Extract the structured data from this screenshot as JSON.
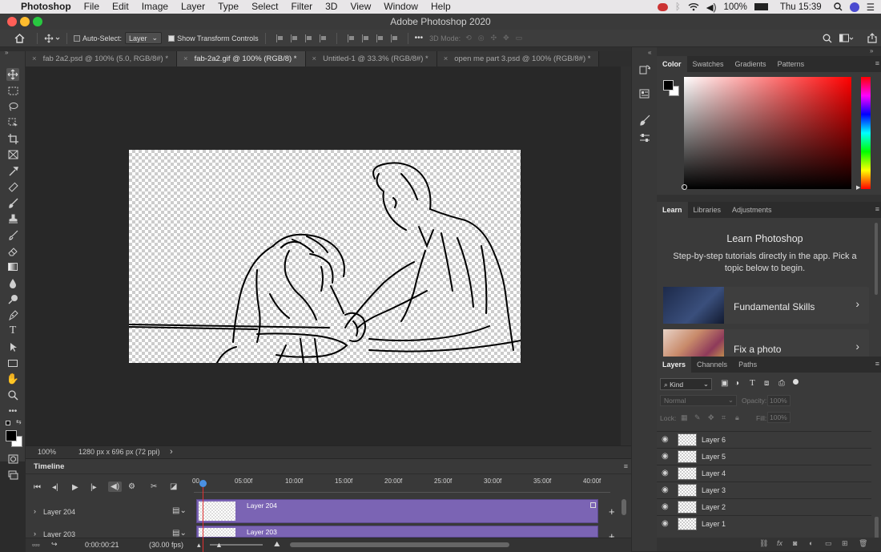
{
  "menubar": {
    "app": "Photoshop",
    "items": [
      "File",
      "Edit",
      "Image",
      "Layer",
      "Type",
      "Select",
      "Filter",
      "3D",
      "View",
      "Window",
      "Help"
    ],
    "battery": "100%",
    "clock": "Thu 15:39"
  },
  "window_title": "Adobe Photoshop 2020",
  "options": {
    "auto_select_label": "Auto-Select:",
    "auto_select_value": "Layer",
    "show_transform": "Show Transform Controls",
    "mode_3d": "3D Mode:",
    "more": "•••"
  },
  "tabs": [
    {
      "label": "fab 2a2.psd @ 100% (5.0, RGB/8#) *"
    },
    {
      "label": "fab-2a2.gif @ 100% (RGB/8) *"
    },
    {
      "label": "Untitled-1 @ 33.3% (RGB/8#) *"
    },
    {
      "label": "open me part 3.psd @ 100% (RGB/8#) *"
    }
  ],
  "status": {
    "zoom": "100%",
    "dims": "1280 px x 696 px (72 ppi)",
    "arrow": "›"
  },
  "timeline": {
    "title": "Timeline",
    "ruler": [
      "00",
      "05:00f",
      "10:00f",
      "15:00f",
      "20:00f",
      "25:00f",
      "30:00f",
      "35:00f",
      "40:00f"
    ],
    "tracks": [
      {
        "name": "Layer 204"
      },
      {
        "name": "Layer 203"
      }
    ],
    "timecode": "0:00:00:21",
    "fps": "(30.00 fps)"
  },
  "color_panel": {
    "tabs": [
      "Color",
      "Swatches",
      "Gradients",
      "Patterns"
    ],
    "hue_color": "#ff0000"
  },
  "learn_panel": {
    "tabs": [
      "Learn",
      "Libraries",
      "Adjustments"
    ],
    "heading": "Learn Photoshop",
    "desc": "Step-by-step tutorials directly in the app. Pick a topic below to begin.",
    "cards": [
      {
        "title": "Fundamental Skills"
      },
      {
        "title": "Fix a photo"
      }
    ]
  },
  "layers_panel": {
    "tabs": [
      "Layers",
      "Channels",
      "Paths"
    ],
    "kind": "Kind",
    "blend": "Normal",
    "opacity_label": "Opacity:",
    "opacity_value": "100%",
    "lock_label": "Lock:",
    "fill_label": "Fill:",
    "fill_value": "100%",
    "layers": [
      {
        "name": "Layer 6"
      },
      {
        "name": "Layer 5"
      },
      {
        "name": "Layer 4"
      },
      {
        "name": "Layer 3"
      },
      {
        "name": "Layer 2"
      },
      {
        "name": "Layer 1"
      }
    ]
  }
}
